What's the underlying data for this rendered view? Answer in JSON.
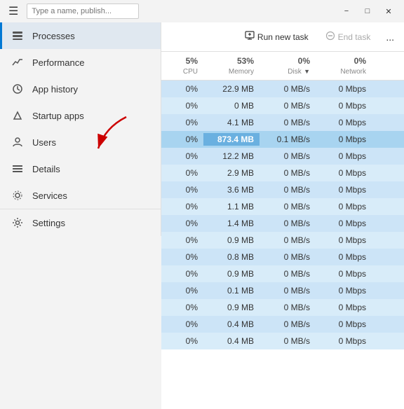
{
  "titlebar": {
    "search_placeholder": "Type a name, publish...",
    "min_label": "−",
    "max_label": "□",
    "close_label": "✕"
  },
  "toolbar": {
    "run_task_label": "Run new task",
    "end_task_label": "End task",
    "more_label": "..."
  },
  "table": {
    "headers": [
      {
        "label": "5%",
        "sub": "CPU"
      },
      {
        "label": "53%",
        "sub": "Memory"
      },
      {
        "label": "0%",
        "sub": "Disk"
      },
      {
        "label": "0%",
        "sub": "Network"
      }
    ],
    "rows": [
      {
        "cpu": "0%",
        "memory": "22.9 MB",
        "disk": "0 MB/s",
        "network": "0 Mbps",
        "highlight": false
      },
      {
        "cpu": "0%",
        "memory": "0 MB",
        "disk": "0 MB/s",
        "network": "0 Mbps",
        "highlight": false
      },
      {
        "cpu": "0%",
        "memory": "4.1 MB",
        "disk": "0 MB/s",
        "network": "0 Mbps",
        "highlight": false
      },
      {
        "cpu": "0%",
        "memory": "873.4 MB",
        "disk": "0.1 MB/s",
        "network": "0 Mbps",
        "highlight": true
      },
      {
        "cpu": "0%",
        "memory": "12.2 MB",
        "disk": "0 MB/s",
        "network": "0 Mbps",
        "highlight": false
      },
      {
        "cpu": "0%",
        "memory": "2.9 MB",
        "disk": "0 MB/s",
        "network": "0 Mbps",
        "highlight": false
      },
      {
        "cpu": "0%",
        "memory": "3.6 MB",
        "disk": "0 MB/s",
        "network": "0 Mbps",
        "highlight": false
      },
      {
        "cpu": "0%",
        "memory": "1.1 MB",
        "disk": "0 MB/s",
        "network": "0 Mbps",
        "highlight": false
      },
      {
        "cpu": "0%",
        "memory": "1.4 MB",
        "disk": "0 MB/s",
        "network": "0 Mbps",
        "highlight": false
      },
      {
        "cpu": "0%",
        "memory": "0.9 MB",
        "disk": "0 MB/s",
        "network": "0 Mbps",
        "highlight": false
      },
      {
        "cpu": "0%",
        "memory": "0.8 MB",
        "disk": "0 MB/s",
        "network": "0 Mbps",
        "highlight": false
      },
      {
        "cpu": "0%",
        "memory": "0.9 MB",
        "disk": "0 MB/s",
        "network": "0 Mbps",
        "highlight": false
      },
      {
        "cpu": "0%",
        "memory": "0.1 MB",
        "disk": "0 MB/s",
        "network": "0 Mbps",
        "highlight": false
      },
      {
        "cpu": "0%",
        "memory": "0.9 MB",
        "disk": "0 MB/s",
        "network": "0 Mbps",
        "highlight": false
      },
      {
        "cpu": "0%",
        "memory": "0.4 MB",
        "disk": "0 MB/s",
        "network": "0 Mbps",
        "highlight": false
      },
      {
        "cpu": "0%",
        "memory": "0.4 MB",
        "disk": "0 MB/s",
        "network": "0 Mbps",
        "highlight": false
      }
    ]
  },
  "sidebar": {
    "items": [
      {
        "label": "Processes",
        "active": true
      },
      {
        "label": "Performance",
        "active": false
      },
      {
        "label": "App history",
        "active": false
      },
      {
        "label": "Startup apps",
        "active": false
      },
      {
        "label": "Users",
        "active": false
      },
      {
        "label": "Details",
        "active": false
      },
      {
        "label": "Services",
        "active": false
      }
    ],
    "bottom_items": [
      {
        "label": "Settings"
      }
    ]
  }
}
